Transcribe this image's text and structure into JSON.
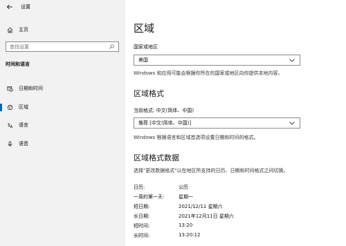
{
  "window": {
    "title": "设置"
  },
  "sidebar": {
    "home_label": "主页",
    "search_placeholder": "查找设置",
    "section_heading": "时间和语言",
    "items": [
      {
        "label": "日期和时间",
        "icon": "calendar-clock-icon",
        "active": false
      },
      {
        "label": "区域",
        "icon": "region-icon",
        "active": true
      },
      {
        "label": "语言",
        "icon": "language-icon",
        "active": false
      },
      {
        "label": "语音",
        "icon": "microphone-icon",
        "active": false
      }
    ]
  },
  "main": {
    "page_title": "区域",
    "country": {
      "label": "国家或地区",
      "value": "美国",
      "description": "Windows 和应用可能会根据你所在的国家或地区向你提供本地内容。"
    },
    "regional_format": {
      "title": "区域格式",
      "current_label": "当前格式: 中文(简体、中国)",
      "value": "推荐 [中文(简体、中国)]",
      "description": "Windows 根据语言和区域首选项设置日期和时间的格式。"
    },
    "format_data": {
      "title": "区域格式数据",
      "description": "选择\"更改数据格式\"以在地区所支持的日历、日期和时间格式之间切换。",
      "rows": [
        {
          "key": "日历:",
          "value": "公历"
        },
        {
          "key": "一周的第一天:",
          "value": "星期一"
        },
        {
          "key": "短日期:",
          "value": "2021/12/11 星期六"
        },
        {
          "key": "长日期:",
          "value": "2021年12月11日 星期六"
        },
        {
          "key": "短时间:",
          "value": "13:20"
        },
        {
          "key": "长时间:",
          "value": "13:20:12"
        }
      ]
    }
  },
  "colors": {
    "sidebar_bg": "#f2f2f2",
    "accent": "#0067b8"
  }
}
